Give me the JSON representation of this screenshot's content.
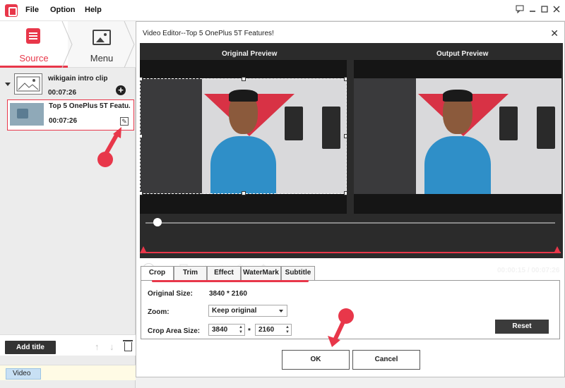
{
  "menubar": {
    "items": [
      "File",
      "Option",
      "Help"
    ]
  },
  "left_nav": {
    "tabs": [
      {
        "label": "Source",
        "icon": "source-document-icon"
      },
      {
        "label": "Menu",
        "icon": "menu-image-icon"
      }
    ]
  },
  "clips": {
    "title_group": {
      "name": "wikigain intro clip",
      "duration": "00:07:26"
    },
    "selected": {
      "name": "Top 5 OnePlus 5T Featu...",
      "duration": "00:07:26"
    }
  },
  "left_bottom": {
    "add_title_label": "Add title",
    "video_tag": "Video"
  },
  "dialog": {
    "title": "Video Editor--Top 5 OnePlus 5T Features!",
    "original_label": "Original Preview",
    "output_label": "Output Preview",
    "time_current": "00:00:15",
    "time_total": "00:07:26",
    "time_separator": "/",
    "playback_progress": 0.03,
    "tabs": [
      "Crop",
      "Trim",
      "Effect",
      "WaterMark",
      "Subtitle"
    ],
    "active_tab": "Crop",
    "settings": {
      "original_size_label": "Original Size:",
      "original_size_value": "3840 * 2160",
      "zoom_label": "Zoom:",
      "zoom_value": "Keep original",
      "crop_area_label": "Crop Area Size:",
      "crop_width": "3840",
      "crop_times": "*",
      "crop_height": "2160",
      "reset_label": "Reset"
    },
    "ok_label": "OK",
    "cancel_label": "Cancel"
  },
  "colors": {
    "accent": "#e8374a",
    "player_bg": "#2b2b2b",
    "dark_button": "#3b3b3b"
  }
}
